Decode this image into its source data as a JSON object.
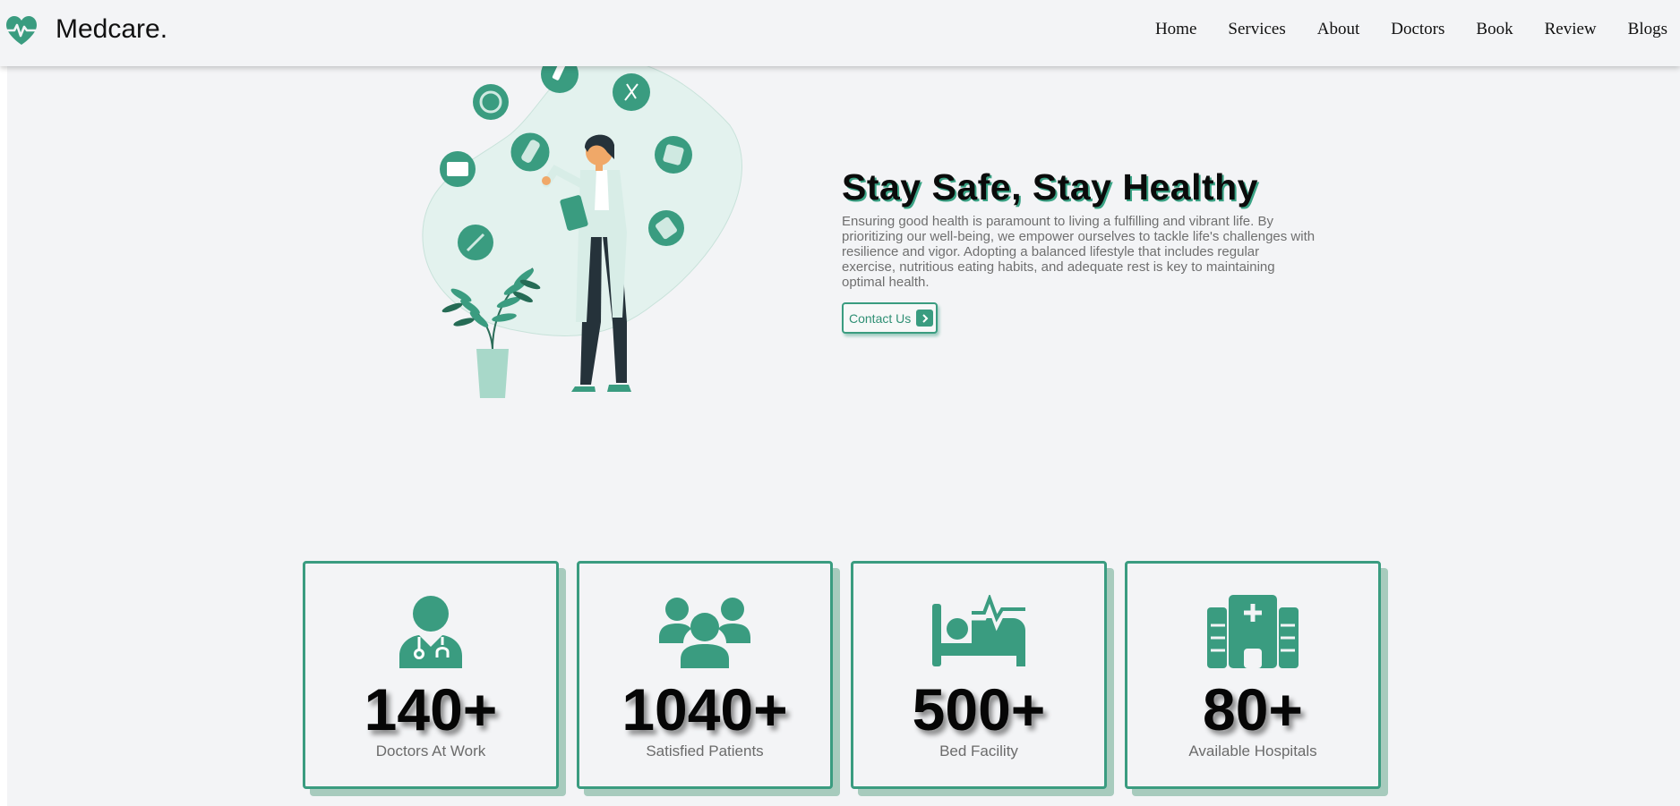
{
  "header": {
    "brand": "Medcare.",
    "logo_icon": "heartbeat-icon",
    "nav": [
      "Home",
      "Services",
      "About",
      "Doctors",
      "Book",
      "Review",
      "Blogs"
    ]
  },
  "hero": {
    "title": "Stay Safe, Stay Healthy",
    "paragraph": "Ensuring good health is paramount to living a fulfilling and vibrant life. By prioritizing our well-being, we empower ourselves to tackle life's challenges with resilience and vigor. Adopting a balanced lifestyle that includes regular exercise, nutritious eating habits, and adequate rest is key to maintaining optimal health.",
    "cta_label": "Contact Us",
    "cta_icon": "chevron-right-icon"
  },
  "stats": [
    {
      "icon": "doctor-icon",
      "number": "140+",
      "label": "Doctors At Work"
    },
    {
      "icon": "users-icon",
      "number": "1040+",
      "label": "Satisfied Patients"
    },
    {
      "icon": "bed-pulse-icon",
      "number": "500+",
      "label": "Bed Facility"
    },
    {
      "icon": "hospital-icon",
      "number": "80+",
      "label": "Available Hospitals"
    }
  ],
  "colors": {
    "accent": "#3a9c80",
    "accent_light": "#a7cbbd",
    "background": "#f3f4f6"
  }
}
